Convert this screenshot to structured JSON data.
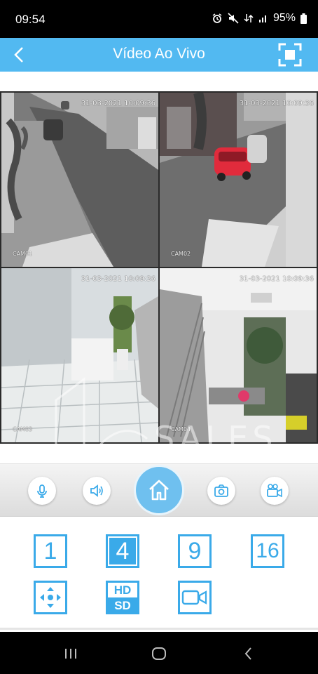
{
  "status_bar": {
    "time": "09:54",
    "battery": "95%",
    "icons": [
      "alarm-icon",
      "mute-icon",
      "data-icon",
      "signal-icon",
      "battery-icon"
    ]
  },
  "app_bar": {
    "title": "Vídeo Ao Vivo",
    "back_icon": "chevron-left-icon",
    "fullscreen_icon": "fullscreen-icon",
    "color": "#52b9f1"
  },
  "cameras": [
    {
      "label": "CAM01",
      "timestamp": "31-03-2021 10:09:36"
    },
    {
      "label": "CAM02",
      "timestamp": "31-03-2021 10:09:36"
    },
    {
      "label": "CAM03",
      "timestamp": "31-03-2021 10:09:36"
    },
    {
      "label": "CAM04",
      "timestamp": "31-03-2021 10:09:36"
    }
  ],
  "controls": {
    "buttons": [
      "microphone-icon",
      "speaker-icon",
      "home-icon",
      "camera-icon",
      "video-record-icon"
    ]
  },
  "layouts": {
    "options": [
      "1",
      "4",
      "9",
      "16"
    ],
    "selected": "4",
    "extra": [
      "ptz-icon",
      "hd-sd-icon",
      "record-icon"
    ],
    "hd_label": "HD",
    "sd_label": "SD",
    "accent": "#3aaae9"
  },
  "nav_bar": {
    "buttons": [
      "recents-icon",
      "home-nav-icon",
      "back-nav-icon"
    ]
  }
}
